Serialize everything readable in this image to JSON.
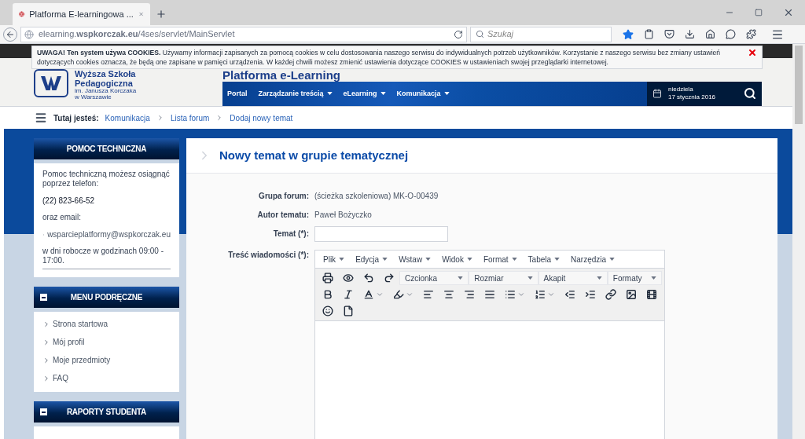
{
  "browser": {
    "tab_title": "Platforma E-learningowa ...",
    "url": "elearning.**wspkorczak.eu**/4ses/servlet/MainServlet",
    "search_placeholder": "Szukaj"
  },
  "cookie_banner": {
    "text": "**UWAGA! Ten system używa COOKIES.** Używamy informacji zapisanych za pomocą cookies w celu dostosowania naszego serwisu do indywidualnych potrzeb użytkowników. Korzystanie z naszego serwisu bez zmiany ustawień dotyczących cookies oznacza, że będą one zapisane w pamięci urządzenia. W każdej chwili możesz zmienić ustawienia dotyczące COOKIES w ustawieniach swojej przeglądarki internetowej."
  },
  "header": {
    "school_name": [
      "Wyższa Szkoła",
      "Pedagogiczna"
    ],
    "school_subtitle": [
      "im. Janusza Korczaka",
      "w Warszawie"
    ],
    "title": "Platforma e-Learning",
    "nav": [
      {
        "label": "Portal",
        "dropdown": false
      },
      {
        "label": "Zarządzanie treścią",
        "dropdown": true
      },
      {
        "label": "eLearning",
        "dropdown": true
      },
      {
        "label": "Komunikacja",
        "dropdown": true
      }
    ],
    "weekday": "niedziela",
    "date": "17 stycznia 2016"
  },
  "breadcrumb": {
    "label": "Tutaj jesteś:",
    "items": [
      "Komunikacja",
      "Lista forum",
      "Dodaj nowy temat"
    ]
  },
  "sidebar": [
    {
      "title": "POMOC TECHNICZNA",
      "collapsible": false,
      "items": [
        {
          "kind": "text",
          "text": "Pomoc techniczną możesz osiągnąć poprzez telefon:"
        },
        {
          "kind": "phone",
          "text": "(22) 823-66-52"
        },
        {
          "kind": "text",
          "text": "oraz email:"
        },
        {
          "kind": "link",
          "text": "wsparcieplatformy@wspkorczak.eu"
        },
        {
          "kind": "text",
          "text": "w dni robocze w godzinach 09:00 - 17:00."
        }
      ]
    },
    {
      "title": "MENU PODRĘCZNE",
      "collapsible": true,
      "items": [
        {
          "kind": "link",
          "text": "Strona startowa"
        },
        {
          "kind": "link",
          "text": "Mój profil"
        },
        {
          "kind": "link",
          "text": "Moje przedmioty"
        },
        {
          "kind": "link",
          "text": "FAQ"
        }
      ]
    },
    {
      "title": "RAPORTY STUDENTA",
      "collapsible": true
    }
  ],
  "main": {
    "title": "Nowy temat w grupie tematycznej",
    "fields": [
      {
        "kind": "text",
        "label": "Grupa forum:",
        "value": "(ścieżka szkoleniowa) MK-O-00439"
      },
      {
        "kind": "text",
        "label": "Autor tematu:",
        "value": "Paweł Bożyczko"
      },
      {
        "kind": "input",
        "label": "Temat (*):"
      },
      {
        "kind": "editor",
        "label": "Treść wiadomości (*):"
      }
    ]
  },
  "editor": {
    "menu": [
      "Plik",
      "Edycja",
      "Wstaw",
      "Widok",
      "Format",
      "Tabela",
      "Narzędzia"
    ],
    "selects": [
      "Czcionka",
      "Rozmiar",
      "Akapit",
      "Formaty"
    ]
  }
}
